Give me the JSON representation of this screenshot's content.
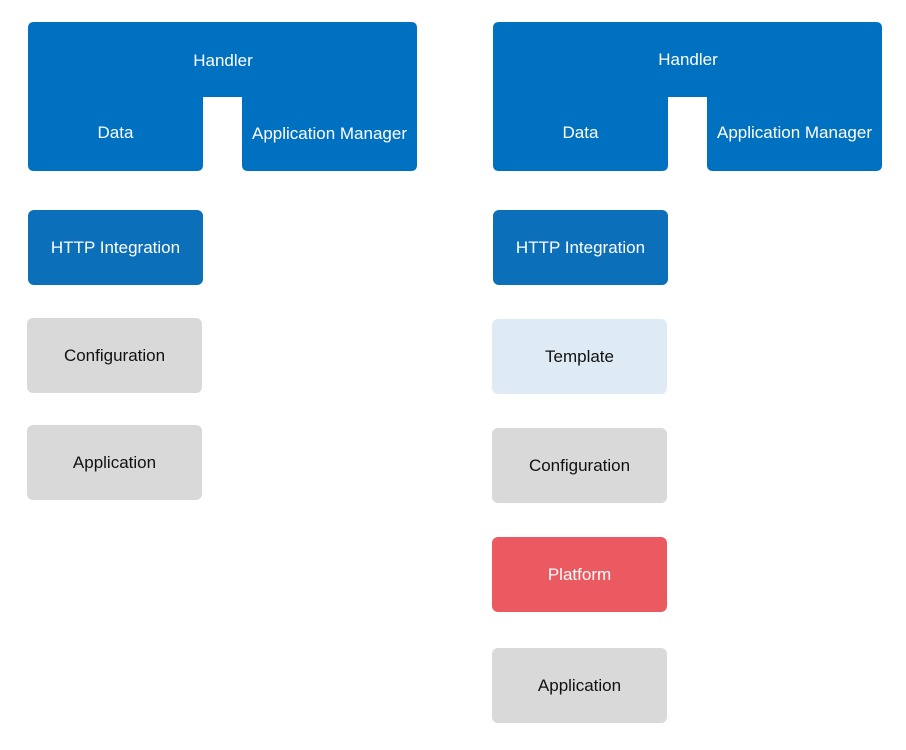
{
  "colors": {
    "handler_blue": "#0070c0",
    "box_blue": "#0b6fba",
    "box_gray": "#d9d9d9",
    "box_light_blue": "#deebf5",
    "box_red": "#eb5a60"
  },
  "left_stack": {
    "handler": {
      "title": "Handler",
      "left_leg": "Data",
      "right_leg": "Application Manager"
    },
    "layers": [
      {
        "label": "HTTP Integration",
        "style": "blue"
      },
      {
        "label": "Configuration",
        "style": "gray"
      },
      {
        "label": "Application",
        "style": "gray"
      }
    ]
  },
  "right_stack": {
    "handler": {
      "title": "Handler",
      "left_leg": "Data",
      "right_leg": "Application Manager"
    },
    "layers": [
      {
        "label": "HTTP Integration",
        "style": "blue"
      },
      {
        "label": "Template",
        "style": "light"
      },
      {
        "label": "Configuration",
        "style": "gray"
      },
      {
        "label": "Platform",
        "style": "red"
      },
      {
        "label": "Application",
        "style": "gray"
      }
    ]
  }
}
